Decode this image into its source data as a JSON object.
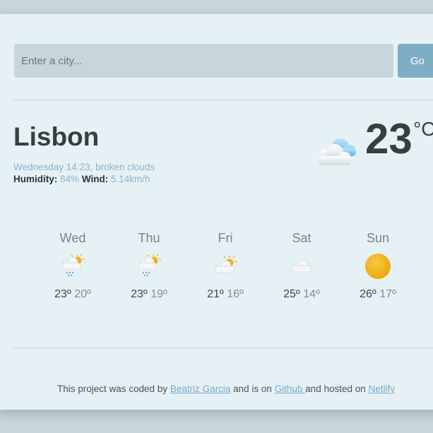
{
  "search": {
    "placeholder": "Enter a city...",
    "button_label": "Go"
  },
  "current": {
    "city": "Lisbon",
    "datetime_desc": "Wednesday 14:23, broken clouds",
    "humidity_label": "Humidity",
    "humidity_value": "84%",
    "wind_label": "Wind",
    "wind_value": "5.14km/h",
    "temperature": "23",
    "unit": "°C",
    "icon": "broken-clouds-icon"
  },
  "forecast": [
    {
      "day": "Wed",
      "max": "23º",
      "min": "20º",
      "icon": "rain-sun-icon"
    },
    {
      "day": "Thu",
      "max": "23º",
      "min": "19º",
      "icon": "rain-sun-icon"
    },
    {
      "day": "Fri",
      "max": "21º",
      "min": "16º",
      "icon": "partly-cloudy-icon"
    },
    {
      "day": "Sat",
      "max": "25º",
      "min": "14º",
      "icon": "cloud-icon"
    },
    {
      "day": "Sun",
      "max": "26º",
      "min": "17º",
      "icon": "sun-icon"
    }
  ],
  "footer": {
    "text_1": "This project was coded by ",
    "author_link": "Beatriz Garcia",
    "text_2": " and is on ",
    "github_link": "Github ",
    "text_3": "and hosted on ",
    "netlify_link": "Netlify"
  },
  "colors": {
    "page_bg": "#c9d5dc",
    "card_bg": "#e6f1f6",
    "input_bg": "#c8d6dc",
    "button_bg": "#7eaec5",
    "accent_text": "#8ab3c9",
    "link": "#7ca9c2",
    "sun": "#f2b21a"
  }
}
